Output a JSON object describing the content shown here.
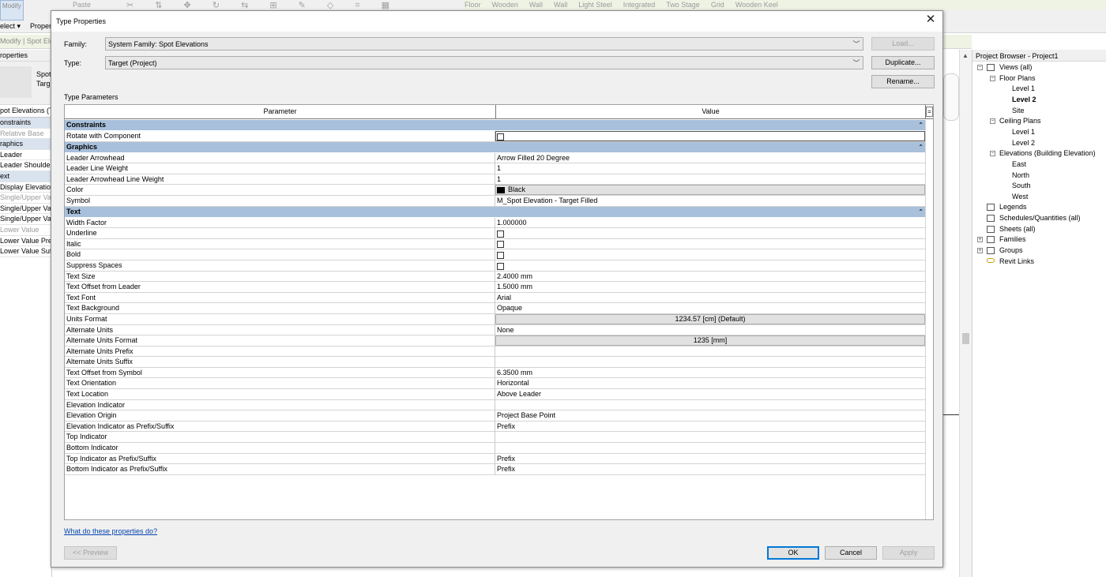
{
  "background": {
    "ribbon": {
      "modify_label": "Modify",
      "select_label": "elect ▾",
      "properties_label": "Proper",
      "paste_label": "Paste",
      "tools": [
        "Floor",
        "Wooden",
        "Wall",
        "Wall",
        "Light Steel",
        "Integrated",
        "Two Stage",
        "Grid",
        "Wooden Keel"
      ]
    },
    "options_bar": "Modify | Spot Ele",
    "properties_panel": {
      "title": "roperties",
      "type_lines": [
        "Spot",
        "Targ"
      ],
      "instance_selector": "pot Elevations (T",
      "rows": [
        {
          "label": "onstraints",
          "kind": "group"
        },
        {
          "label": "Relative Base",
          "kind": "dim"
        },
        {
          "label": "raphics",
          "kind": "group"
        },
        {
          "label": "Leader",
          "kind": "normal"
        },
        {
          "label": "Leader Shoulder",
          "kind": "normal"
        },
        {
          "label": "ext",
          "kind": "group"
        },
        {
          "label": "Display Elevation",
          "kind": "normal"
        },
        {
          "label": "Single/Upper Val",
          "kind": "dim"
        },
        {
          "label": "Single/Upper Val",
          "kind": "normal"
        },
        {
          "label": "Single/Upper Val",
          "kind": "normal"
        },
        {
          "label": "Lower Value",
          "kind": "dim"
        },
        {
          "label": "Lower Value Pref",
          "kind": "normal"
        },
        {
          "label": "Lower Value Suff",
          "kind": "normal"
        }
      ]
    },
    "project_browser": {
      "title": "Project Browser - Project1",
      "nodes": [
        {
          "label": "Views (all)",
          "toggle": "−",
          "icon": "views",
          "level": 0
        },
        {
          "label": "Floor Plans",
          "toggle": "−",
          "level": 1
        },
        {
          "label": "Level 1",
          "level": 2
        },
        {
          "label": "Level 2",
          "level": 2,
          "bold": true
        },
        {
          "label": "Site",
          "level": 2
        },
        {
          "label": "Ceiling Plans",
          "toggle": "−",
          "level": 1
        },
        {
          "label": "Level 1",
          "level": 2
        },
        {
          "label": "Level 2",
          "level": 2
        },
        {
          "label": "Elevations (Building Elevation)",
          "toggle": "−",
          "level": 1
        },
        {
          "label": "East",
          "level": 2
        },
        {
          "label": "North",
          "level": 2
        },
        {
          "label": "South",
          "level": 2
        },
        {
          "label": "West",
          "level": 2
        },
        {
          "label": "Legends",
          "icon": "legends",
          "level": 0
        },
        {
          "label": "Schedules/Quantities (all)",
          "icon": "schedules",
          "level": 0
        },
        {
          "label": "Sheets (all)",
          "icon": "sheets",
          "level": 0
        },
        {
          "label": "Families",
          "toggle": "+",
          "icon": "families",
          "level": 0
        },
        {
          "label": "Groups",
          "toggle": "+",
          "icon": "groups",
          "level": 0
        },
        {
          "label": "Revit Links",
          "icon": "links",
          "level": 0
        }
      ]
    }
  },
  "dialog": {
    "title": "Type Properties",
    "family_label": "Family:",
    "family_value": "System Family: Spot Elevations",
    "type_label": "Type:",
    "type_value": "Target (Project)",
    "load_button": "Load...",
    "duplicate_button": "Duplicate...",
    "rename_button": "Rename...",
    "section_label": "Type Parameters",
    "columns": {
      "parameter": "Parameter",
      "value": "Value",
      "eq": "="
    },
    "rows": [
      {
        "kind": "group",
        "label": "Constraints"
      },
      {
        "kind": "param",
        "label": "Rotate with Component",
        "valueType": "field-checkbox"
      },
      {
        "kind": "group",
        "label": "Graphics"
      },
      {
        "kind": "param",
        "label": "Leader Arrowhead",
        "value": "Arrow Filled 20 Degree"
      },
      {
        "kind": "param",
        "label": "Leader Line Weight",
        "value": "1"
      },
      {
        "kind": "param",
        "label": "Leader Arrowhead Line Weight",
        "value": "1"
      },
      {
        "kind": "param",
        "label": "Color",
        "value": "Black",
        "valueType": "color",
        "swatch": "#000000"
      },
      {
        "kind": "param",
        "label": "Symbol",
        "value": "M_Spot Elevation - Target Filled"
      },
      {
        "kind": "group",
        "label": "Text"
      },
      {
        "kind": "param",
        "label": "Width Factor",
        "value": "1.000000"
      },
      {
        "kind": "param",
        "label": "Underline",
        "valueType": "checkbox"
      },
      {
        "kind": "param",
        "label": "Italic",
        "valueType": "checkbox"
      },
      {
        "kind": "param",
        "label": "Bold",
        "valueType": "checkbox"
      },
      {
        "kind": "param",
        "label": "Suppress Spaces",
        "valueType": "checkbox"
      },
      {
        "kind": "param",
        "label": "Text Size",
        "value": "2.4000 mm"
      },
      {
        "kind": "param",
        "label": "Text Offset from Leader",
        "value": "1.5000 mm"
      },
      {
        "kind": "param",
        "label": "Text Font",
        "value": "Arial"
      },
      {
        "kind": "param",
        "label": "Text Background",
        "value": "Opaque"
      },
      {
        "kind": "param",
        "label": "Units Format",
        "value": "1234.57 [cm] (Default)",
        "valueType": "button"
      },
      {
        "kind": "param",
        "label": "Alternate Units",
        "value": "None"
      },
      {
        "kind": "param",
        "label": "Alternate Units Format",
        "value": "1235 [mm]",
        "valueType": "button"
      },
      {
        "kind": "param",
        "label": "Alternate Units Prefix",
        "value": ""
      },
      {
        "kind": "param",
        "label": "Alternate Units Suffix",
        "value": ""
      },
      {
        "kind": "param",
        "label": "Text Offset from Symbol",
        "value": "6.3500 mm"
      },
      {
        "kind": "param",
        "label": "Text Orientation",
        "value": "Horizontal"
      },
      {
        "kind": "param",
        "label": "Text Location",
        "value": "Above Leader"
      },
      {
        "kind": "param",
        "label": "Elevation Indicator",
        "value": ""
      },
      {
        "kind": "param",
        "label": "Elevation Origin",
        "value": "Project Base Point"
      },
      {
        "kind": "param",
        "label": "Elevation Indicator as Prefix/Suffix",
        "value": "Prefix"
      },
      {
        "kind": "param",
        "label": "Top Indicator",
        "value": ""
      },
      {
        "kind": "param",
        "label": "Bottom Indicator",
        "value": ""
      },
      {
        "kind": "param",
        "label": "Top Indicator as Prefix/Suffix",
        "value": "Prefix"
      },
      {
        "kind": "param",
        "label": "Bottom Indicator as Prefix/Suffix",
        "value": "Prefix"
      }
    ],
    "help_link": "What do these properties do?",
    "preview_button": "<< Preview",
    "ok_button": "OK",
    "cancel_button": "Cancel",
    "apply_button": "Apply"
  }
}
